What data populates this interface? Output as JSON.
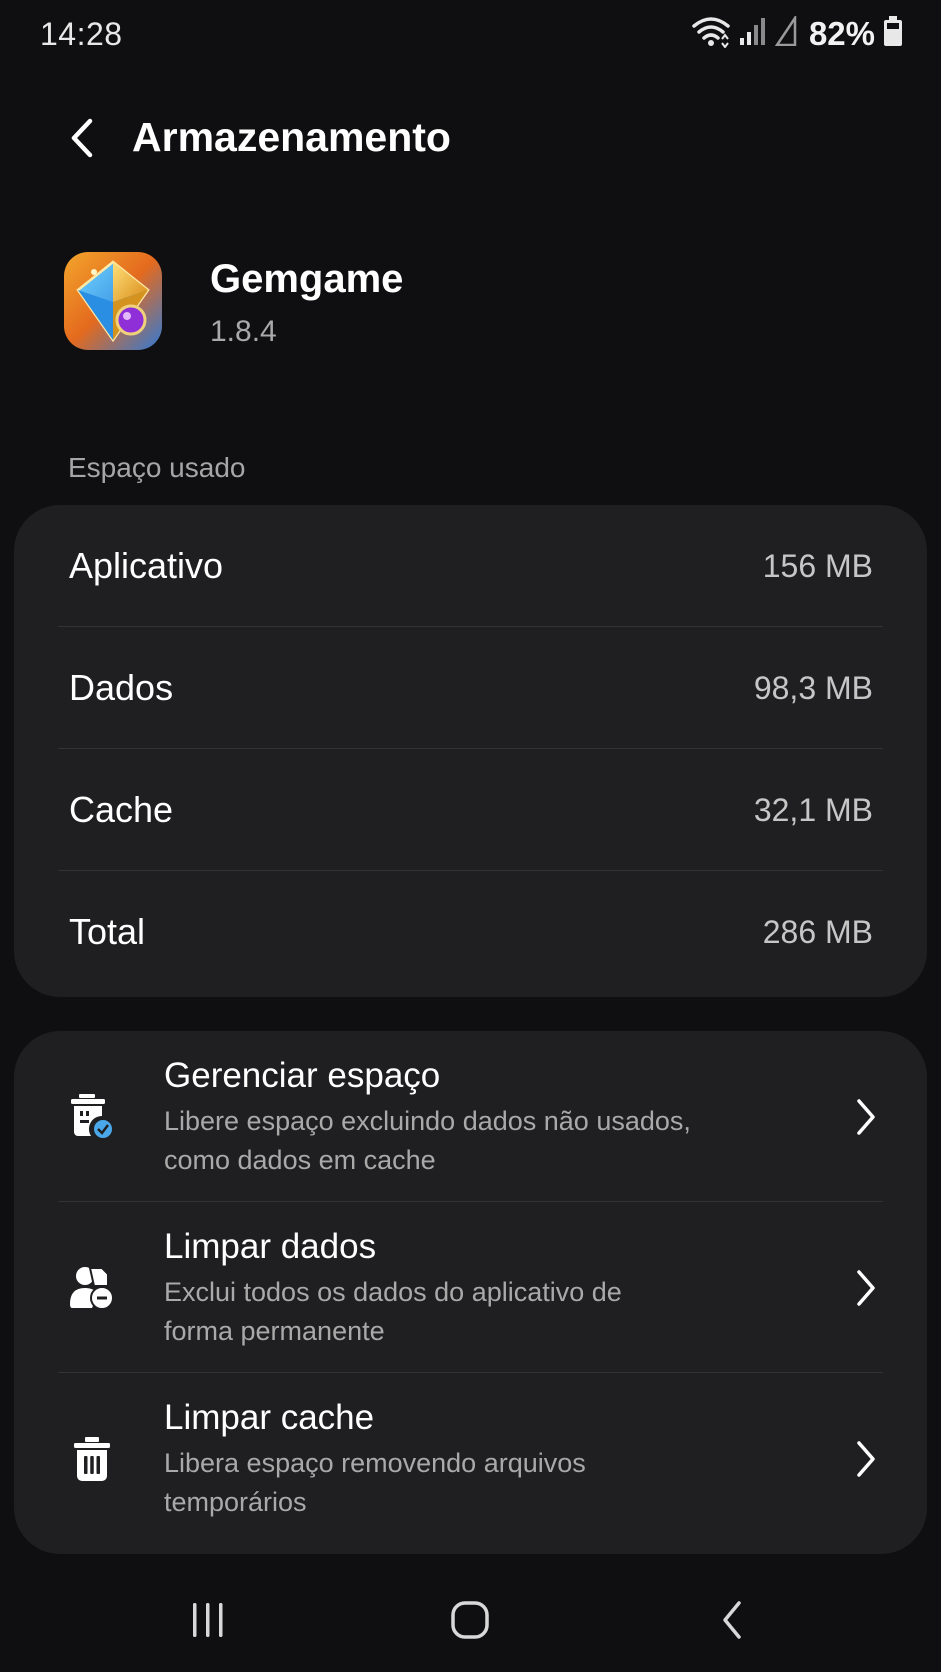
{
  "status_bar": {
    "time": "14:28",
    "battery_percent": "82%",
    "icons": [
      "wifi-icon",
      "signal-icon",
      "signal-secondary-icon",
      "battery-icon"
    ]
  },
  "header": {
    "title": "Armazenamento",
    "back_icon": "chevron-left-icon"
  },
  "app": {
    "name": "Gemgame",
    "version": "1.8.4",
    "icon": "gem-app-icon"
  },
  "storage": {
    "section_label": "Espaço usado",
    "rows": [
      {
        "label": "Aplicativo",
        "value": "156 MB"
      },
      {
        "label": "Dados",
        "value": "98,3 MB"
      },
      {
        "label": "Cache",
        "value": "32,1 MB"
      },
      {
        "label": "Total",
        "value": "286 MB"
      }
    ]
  },
  "actions": [
    {
      "title": "Gerenciar espaço",
      "description_line1": "Libere espaço excluindo dados não usados,",
      "description_line2": "como dados em cache",
      "icon": "manage-storage-icon"
    },
    {
      "title": "Limpar dados",
      "description_line1": "Exclui todos os dados do aplicativo de",
      "description_line2": "forma permanente",
      "icon": "clear-data-icon"
    },
    {
      "title": "Limpar cache",
      "description_line1": "Libera espaço removendo arquivos",
      "description_line2": "temporários",
      "icon": "trash-icon"
    }
  ],
  "nav_bar": {
    "icons": [
      "recent-apps-icon",
      "home-icon",
      "back-icon"
    ]
  },
  "colors": {
    "background": "#0f0f11",
    "card": "#1f1f21",
    "divider": "#333336",
    "secondary_text": "#a9a9a9",
    "accent_blue": "#4aa8ea"
  }
}
